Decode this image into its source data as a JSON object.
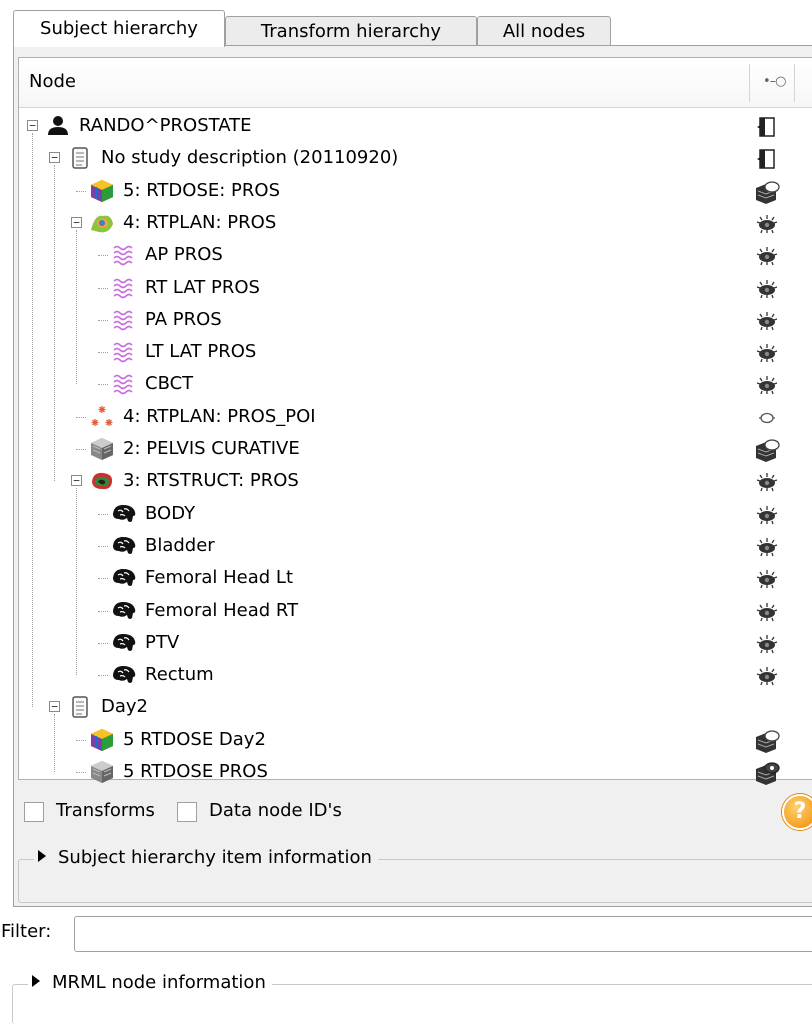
{
  "tabs": [
    {
      "label": "Subject hierarchy",
      "active": true
    },
    {
      "label": "Transform hierarchy",
      "active": false
    },
    {
      "label": "All nodes",
      "active": false
    }
  ],
  "tree_header": {
    "node_label": "Node",
    "visibility_icon": "pin-icon"
  },
  "tree_rows": [
    {
      "label": "RANDO^PROSTATE",
      "icon": "patient-icon",
      "expander": "minus",
      "visibility": "scene-icon"
    },
    {
      "label": "No study description (20110920)",
      "icon": "study-icon",
      "expander": "minus",
      "visibility": "scene-icon"
    },
    {
      "label": "5: RTDOSE: PROS",
      "icon": "dose-volume-icon",
      "expander": null,
      "visibility": "volume-visibility-icon"
    },
    {
      "label": "4: RTPLAN: PROS",
      "icon": "rtplan-icon",
      "expander": "minus",
      "visibility": "eye-icon"
    },
    {
      "label": "AP PROS",
      "icon": "beam-icon",
      "expander": null,
      "visibility": "eye-icon"
    },
    {
      "label": "RT LAT PROS",
      "icon": "beam-icon",
      "expander": null,
      "visibility": "eye-icon"
    },
    {
      "label": "PA PROS",
      "icon": "beam-icon",
      "expander": null,
      "visibility": "eye-icon"
    },
    {
      "label": "LT LAT PROS",
      "icon": "beam-icon",
      "expander": null,
      "visibility": "eye-icon"
    },
    {
      "label": "CBCT",
      "icon": "beam-icon",
      "expander": null,
      "visibility": "eye-icon"
    },
    {
      "label": "4: RTPLAN: PROS_POI",
      "icon": "markups-icon",
      "expander": null,
      "visibility": "eye-closed-icon"
    },
    {
      "label": "2: PELVIS CURATIVE",
      "icon": "ct-volume-icon",
      "expander": null,
      "visibility": "volume-visibility-icon"
    },
    {
      "label": "3: RTSTRUCT: PROS",
      "icon": "segmentation-icon",
      "expander": "minus",
      "visibility": "eye-icon"
    },
    {
      "label": "BODY",
      "icon": "segment-icon",
      "expander": null,
      "visibility": "eye-icon"
    },
    {
      "label": "Bladder",
      "icon": "segment-icon",
      "expander": null,
      "visibility": "eye-icon"
    },
    {
      "label": "Femoral Head Lt",
      "icon": "segment-icon",
      "expander": null,
      "visibility": "eye-icon"
    },
    {
      "label": "Femoral Head RT",
      "icon": "segment-icon",
      "expander": null,
      "visibility": "eye-icon"
    },
    {
      "label": "PTV",
      "icon": "segment-icon",
      "expander": null,
      "visibility": "eye-icon"
    },
    {
      "label": "Rectum",
      "icon": "segment-icon",
      "expander": null,
      "visibility": "eye-icon"
    },
    {
      "label": "Day2",
      "icon": "study-icon",
      "expander": "minus",
      "visibility": null
    },
    {
      "label": "5 RTDOSE Day2",
      "icon": "dose-volume-icon",
      "expander": null,
      "visibility": "volume-visibility-icon"
    },
    {
      "label": "5 RTDOSE PROS",
      "icon": "ct-volume-icon",
      "expander": null,
      "visibility": "volume-visibility-on-icon"
    }
  ],
  "options": {
    "transforms_label": "Transforms",
    "data_node_ids_label": "Data node ID's",
    "help_icon": "help-icon",
    "help_glyph": "?"
  },
  "sh_info": {
    "label": "Subject hierarchy item information"
  },
  "filter": {
    "label": "Filter:",
    "value": "",
    "placeholder": ""
  },
  "mrml_info": {
    "label": "MRML node information"
  }
}
